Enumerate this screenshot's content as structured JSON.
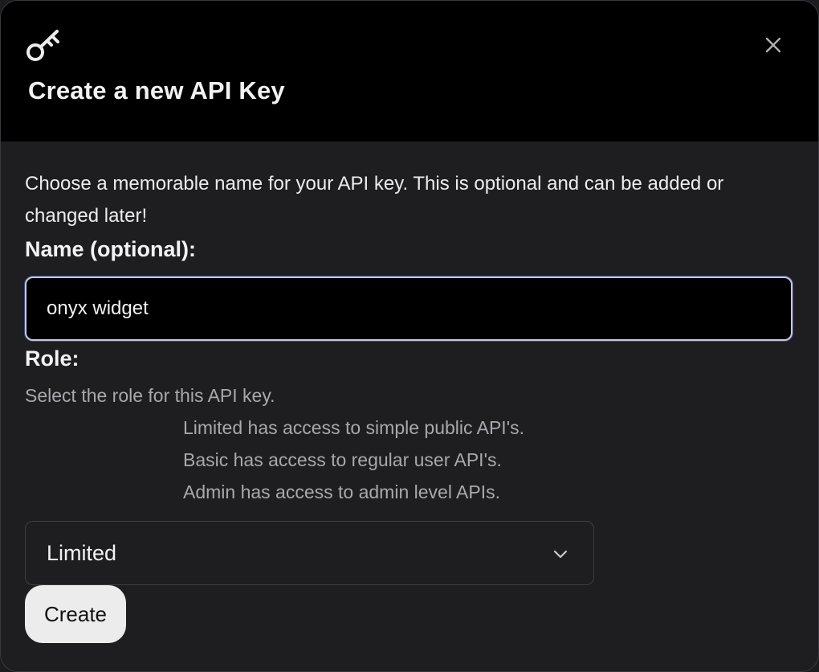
{
  "modal": {
    "title": "Create a new API Key",
    "description": "Choose a memorable name for your API key. This is optional and can be added or changed later!",
    "icons": {
      "header": "key-icon",
      "close": "close-icon",
      "select": "chevron-down-icon"
    }
  },
  "form": {
    "name_label": "Name (optional):",
    "name_value": "onyx widget",
    "role_label": "Role:",
    "role_help": "Select the role for this API key.",
    "role_descriptions": [
      "Limited has access to simple public API's.",
      "Basic has access to regular user API's.",
      "Admin has access to admin level APIs."
    ],
    "role_selected": "Limited",
    "create_label": "Create"
  },
  "colors": {
    "background": "#1e1e21",
    "header": "#000000",
    "text": "#f2f2f2",
    "muted_text": "#a8a8ad",
    "button": "#ececec"
  }
}
